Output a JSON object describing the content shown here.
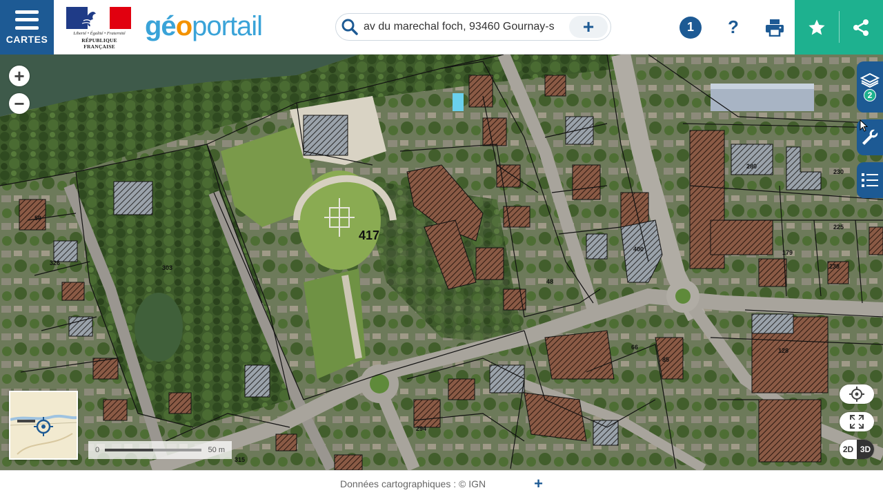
{
  "header": {
    "menu_label": "CARTES",
    "republic_motto": "Liberté • Égalité • Fraternité",
    "republic_name": "RÉPUBLIQUE FRANÇAISE",
    "brand_geo": "gé",
    "brand_o": "o",
    "brand_portail": "portail",
    "search_value": "av du marechal foch, 93460 Gournay-s",
    "search_add": "+",
    "notification_count": "1",
    "help": "?"
  },
  "map": {
    "zoom_in": "+",
    "zoom_out": "−",
    "layers_count": "2",
    "mode_2d": "2D",
    "mode_3d": "3D",
    "scale_start": "0",
    "scale_end": "50 m",
    "parcel_labels": [
      {
        "text": "417",
        "big": true
      },
      {
        "text": "303"
      },
      {
        "text": "326"
      },
      {
        "text": "400"
      },
      {
        "text": "280"
      },
      {
        "text": "230"
      },
      {
        "text": "179"
      },
      {
        "text": "225"
      },
      {
        "text": "238"
      },
      {
        "text": "85"
      },
      {
        "text": "66"
      },
      {
        "text": "294"
      },
      {
        "text": "128"
      },
      {
        "text": "48"
      },
      {
        "text": "59"
      },
      {
        "text": "315"
      }
    ]
  },
  "footer": {
    "attribution": "Données cartographiques : ©   IGN",
    "plus": "+"
  },
  "colors": {
    "primary": "#1d5a94",
    "accent": "#1eb18f",
    "brand_blue": "#3aa3d8",
    "brand_orange": "#f39200"
  }
}
